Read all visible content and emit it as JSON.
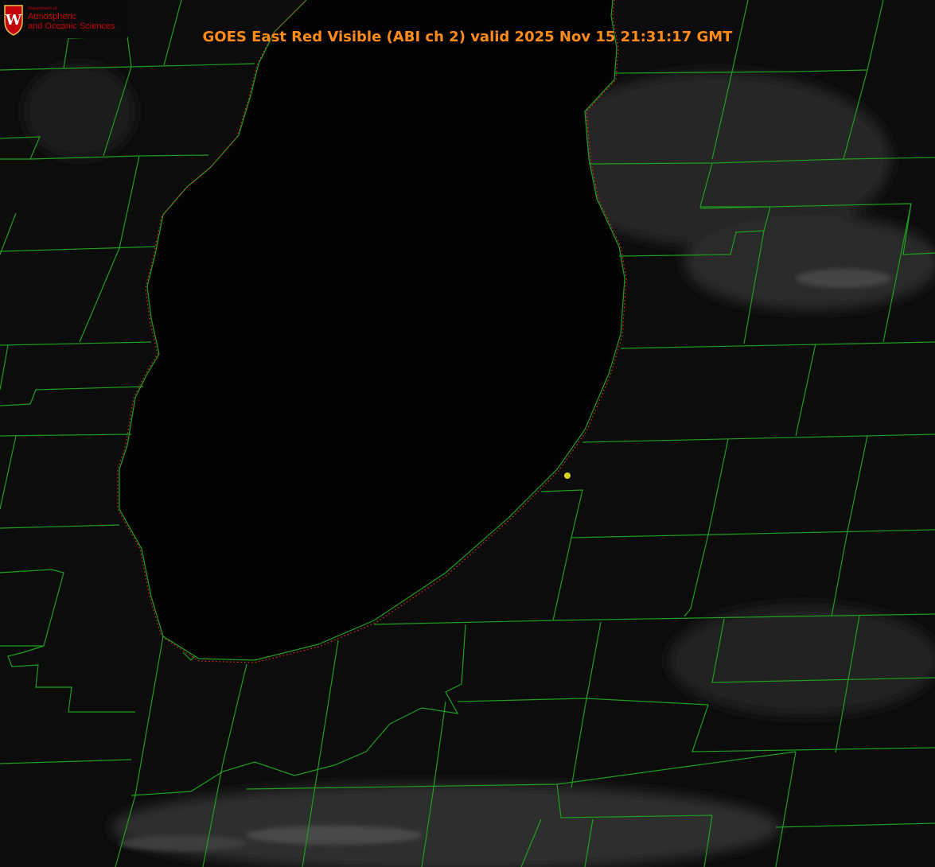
{
  "title": "GOES East Red Visible (ABI ch 2) valid 2025 Nov 15 21:31:17 GMT",
  "logo": {
    "department": "Department of",
    "line1": "Atmospheric",
    "line2": "and Oceanic Sciences",
    "seal_letter": "W"
  },
  "colors": {
    "background": "#000000",
    "county_lines": "#1f9e1f",
    "shoreline_dots": "#e0302a",
    "title": "#ff8c1a",
    "logo_red": "#c5050c",
    "marker": "#d8d21e"
  }
}
